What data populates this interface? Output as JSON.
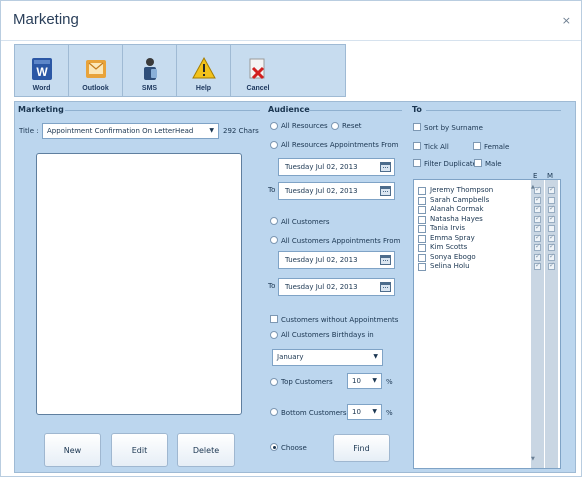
{
  "window": {
    "title": "Marketing",
    "close_glyph": "×"
  },
  "toolbar": {
    "buttons": [
      {
        "label": "Word",
        "icon": "word-icon"
      },
      {
        "label": "Outlook",
        "icon": "outlook-icon"
      },
      {
        "label": "SMS",
        "icon": "sms-icon"
      },
      {
        "label": "Help",
        "icon": "help-icon"
      },
      {
        "label": "Cancel",
        "icon": "cancel-icon"
      }
    ]
  },
  "marketing": {
    "group_title": "Marketing",
    "title_label": "Title :",
    "title_value": "Appointment Confirmation On LetterHead",
    "chars": "292 Chars",
    "message_text": "",
    "buttons": {
      "new": "New",
      "edit": "Edit",
      "delete": "Delete"
    }
  },
  "audience": {
    "group_title": "Audience",
    "all_resources": "All Resources",
    "reset": "Reset",
    "all_resources_appts_from": "All Resources Appointments From",
    "date_from_1": "Tuesday Jul  02, 2013",
    "to_label": "To",
    "date_to_1": "Tuesday Jul  02, 2013",
    "all_customers": "All Customers",
    "all_customers_appts_from": "All Customers Appointments From",
    "date_from_2": "Tuesday Jul  02, 2013",
    "date_to_2": "Tuesday Jul  02, 2013",
    "customers_without_appts": "Customers without Appointments",
    "all_customers_birthdays": "All Customers Birthdays in",
    "month": "January",
    "top_customers": "Top Customers",
    "top_value": "10",
    "bottom_customers": "Bottom Customers",
    "bottom_value": "10",
    "percent": "%",
    "choose": "Choose",
    "find": "Find"
  },
  "to": {
    "group_title": "To",
    "sort_by_surname": "Sort by Surname",
    "tick_all": "Tick All",
    "female": "Female",
    "filter_duplicates": "Filter Duplicates",
    "male": "Male",
    "col_e": "E",
    "col_m": "M",
    "recipients": [
      {
        "name": "Jeremy Thompson",
        "e": true,
        "m": true
      },
      {
        "name": "Sarah Campbells",
        "e": true,
        "m": false
      },
      {
        "name": "Alanah Cormak",
        "e": true,
        "m": true
      },
      {
        "name": "Natasha Hayes",
        "e": true,
        "m": true
      },
      {
        "name": "Tania Irvis",
        "e": true,
        "m": false
      },
      {
        "name": "Emma Spray",
        "e": true,
        "m": true
      },
      {
        "name": "Kim Scotts",
        "e": true,
        "m": true
      },
      {
        "name": "Sonya Ebogo",
        "e": true,
        "m": true
      },
      {
        "name": "Selina Holu",
        "e": true,
        "m": true
      }
    ]
  }
}
